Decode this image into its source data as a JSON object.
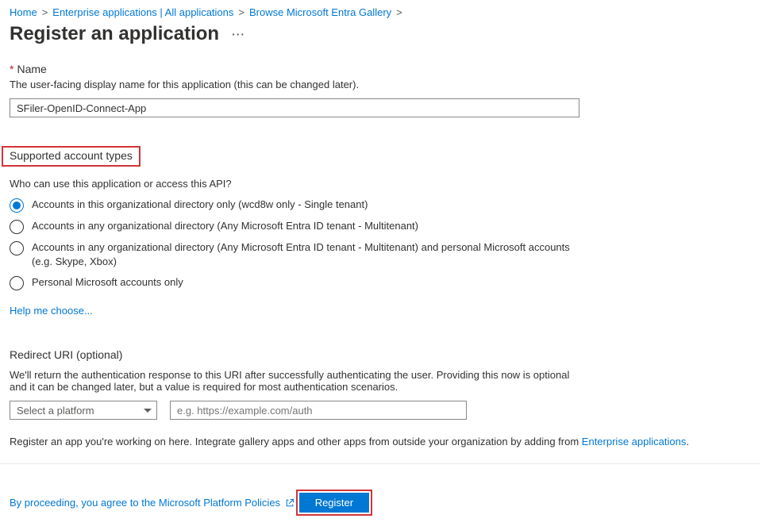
{
  "breadcrumb": {
    "home": "Home",
    "ent_apps": "Enterprise applications | All applications",
    "browse": "Browse Microsoft Entra Gallery"
  },
  "page_title": "Register an application",
  "name_section": {
    "label": "Name",
    "help": "The user-facing display name for this application (this can be changed later).",
    "value": "SFiler-OpenID-Connect-App"
  },
  "account_types": {
    "heading": "Supported account types",
    "question": "Who can use this application or access this API?",
    "options": [
      "Accounts in this organizational directory only (wcd8w only - Single tenant)",
      "Accounts in any organizational directory (Any Microsoft Entra ID tenant - Multitenant)",
      "Accounts in any organizational directory (Any Microsoft Entra ID tenant - Multitenant) and personal Microsoft accounts (e.g. Skype, Xbox)",
      "Personal Microsoft accounts only"
    ],
    "selected_index": 0,
    "help_link": "Help me choose..."
  },
  "redirect": {
    "heading": "Redirect URI (optional)",
    "help": "We'll return the authentication response to this URI after successfully authenticating the user. Providing this now is optional and it can be changed later, but a value is required for most authentication scenarios.",
    "platform_placeholder": "Select a platform",
    "uri_placeholder": "e.g. https://example.com/auth"
  },
  "bottom_note": {
    "prefix": "Register an app you're working on here. Integrate gallery apps and other apps from outside your organization by adding from ",
    "link": "Enterprise applications",
    "suffix": "."
  },
  "policies_text": "By proceeding, you agree to the Microsoft Platform Policies",
  "register_label": "Register"
}
